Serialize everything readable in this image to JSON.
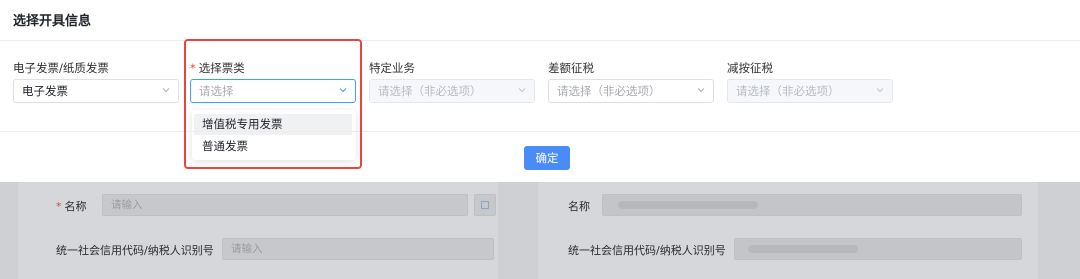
{
  "dialog": {
    "title": "选择开具信息",
    "fields": [
      {
        "label": "电子发票/纸质发票",
        "required": false,
        "value": "电子发票",
        "placeholder": "",
        "disabled": false
      },
      {
        "label": "选择票类",
        "required": true,
        "value": "",
        "placeholder": "请选择",
        "disabled": false,
        "open": true
      },
      {
        "label": "特定业务",
        "required": false,
        "value": "",
        "placeholder": "请选择（非必选项）",
        "disabled": true
      },
      {
        "label": "差额征税",
        "required": false,
        "value": "",
        "placeholder": "请选择（非必选项）",
        "disabled": false
      },
      {
        "label": "减按征税",
        "required": false,
        "value": "",
        "placeholder": "请选择（非必选项）",
        "disabled": true
      }
    ],
    "dropdown_options": [
      "增值税专用发票",
      "普通发票"
    ],
    "confirm_label": "确定",
    "required_mark": "*"
  },
  "background_form": {
    "left": {
      "name_label": "名称",
      "name_placeholder": "请输入",
      "taxid_label": "统一社会信用代码/纳税人识别号",
      "taxid_placeholder": "请输入"
    },
    "right": {
      "name_label": "名称",
      "taxid_label": "统一社会信用代码/纳税人识别号"
    }
  },
  "colors": {
    "primary": "#4a8cf7",
    "required": "#f04134",
    "highlight": "#e8463a"
  }
}
